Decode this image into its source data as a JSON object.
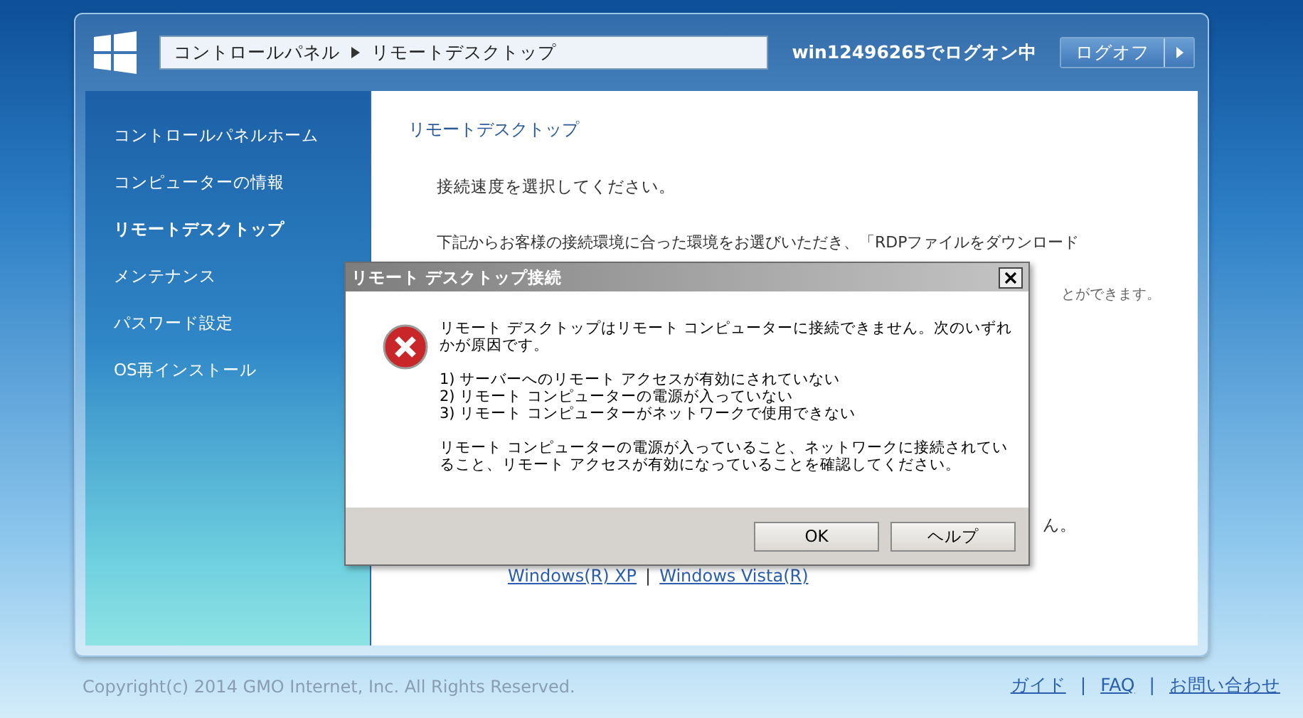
{
  "header": {
    "breadcrumb": [
      {
        "label": "コントロールパネル"
      },
      {
        "label": "リモートデスクトップ"
      }
    ],
    "logon_status": "win12496265でログオン中",
    "logoff_button": "ログオフ"
  },
  "sidebar": {
    "items": [
      {
        "label": "コントロールパネルホーム",
        "selected": false
      },
      {
        "label": "コンピューターの情報",
        "selected": false
      },
      {
        "label": "リモートデスクトップ",
        "selected": true
      },
      {
        "label": "メンテナンス",
        "selected": false
      },
      {
        "label": "パスワード設定",
        "selected": false
      },
      {
        "label": "OS再インストール",
        "selected": false
      }
    ]
  },
  "content": {
    "title": "リモートデスクトップ",
    "instruction": "接続速度を選択してください。",
    "paragraph": "下記からお客様の接続環境に合った環境をお選びいただき、「RDPファイルをダウンロード",
    "fragment_1": "とができます。",
    "fragment_2": "ん。",
    "os_links": [
      "Windows(R) XP",
      "Windows Vista(R)"
    ],
    "link_separator": "|"
  },
  "dialog": {
    "title": "リモート デスクトップ接続",
    "message": "リモート デスクトップはリモート コンピューターに接続できません。次のいずれかが原因です。",
    "reasons": [
      "1) サーバーへのリモート アクセスが有効にされていない",
      "2) リモート コンピューターの電源が入っていない",
      "3) リモート コンピューターがネットワークで使用できない"
    ],
    "advice": "リモート コンピューターの電源が入っていること、ネットワークに接続されていること、リモート アクセスが有効になっていることを確認してください。",
    "buttons": [
      "OK",
      "ヘルプ"
    ]
  },
  "footer": {
    "copyright": "Copyright(c) 2014 GMO Internet, Inc. All Rights Reserved.",
    "links": [
      "ガイド",
      "FAQ",
      "お問い合わせ"
    ],
    "separator": "|"
  }
}
